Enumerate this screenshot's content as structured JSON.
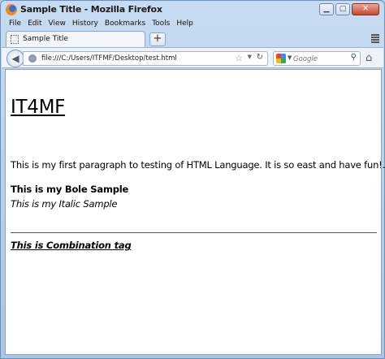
{
  "window": {
    "title": "Sample Title - Mozilla Firefox",
    "controls": {
      "minimize": "▭",
      "maximize": "□",
      "close": "✕"
    }
  },
  "menu": {
    "items": [
      "File",
      "Edit",
      "View",
      "History",
      "Bookmarks",
      "Tools",
      "Help"
    ]
  },
  "tabs": {
    "active_label": "Sample Title",
    "new_tab_label": "+"
  },
  "navbar": {
    "url": "file:///C:/Users/ITFMF/Desktop/test.html",
    "search_placeholder": "Google",
    "icons": [
      "back-icon",
      "site-identity-icon",
      "bookmark-star-icon",
      "url-dropmarker-icon",
      "reload-icon",
      "search-engine-icon",
      "search-go-icon",
      "home-icon"
    ]
  },
  "page": {
    "heading": "IT4MF",
    "paragraph": "This is my first paragraph to testing of HTML Language. It is so east and have fun!.",
    "bold_text": "This is my Bole Sample",
    "italic_text": "This is my Italic Sample",
    "combination_text": "This is Combination tag"
  }
}
